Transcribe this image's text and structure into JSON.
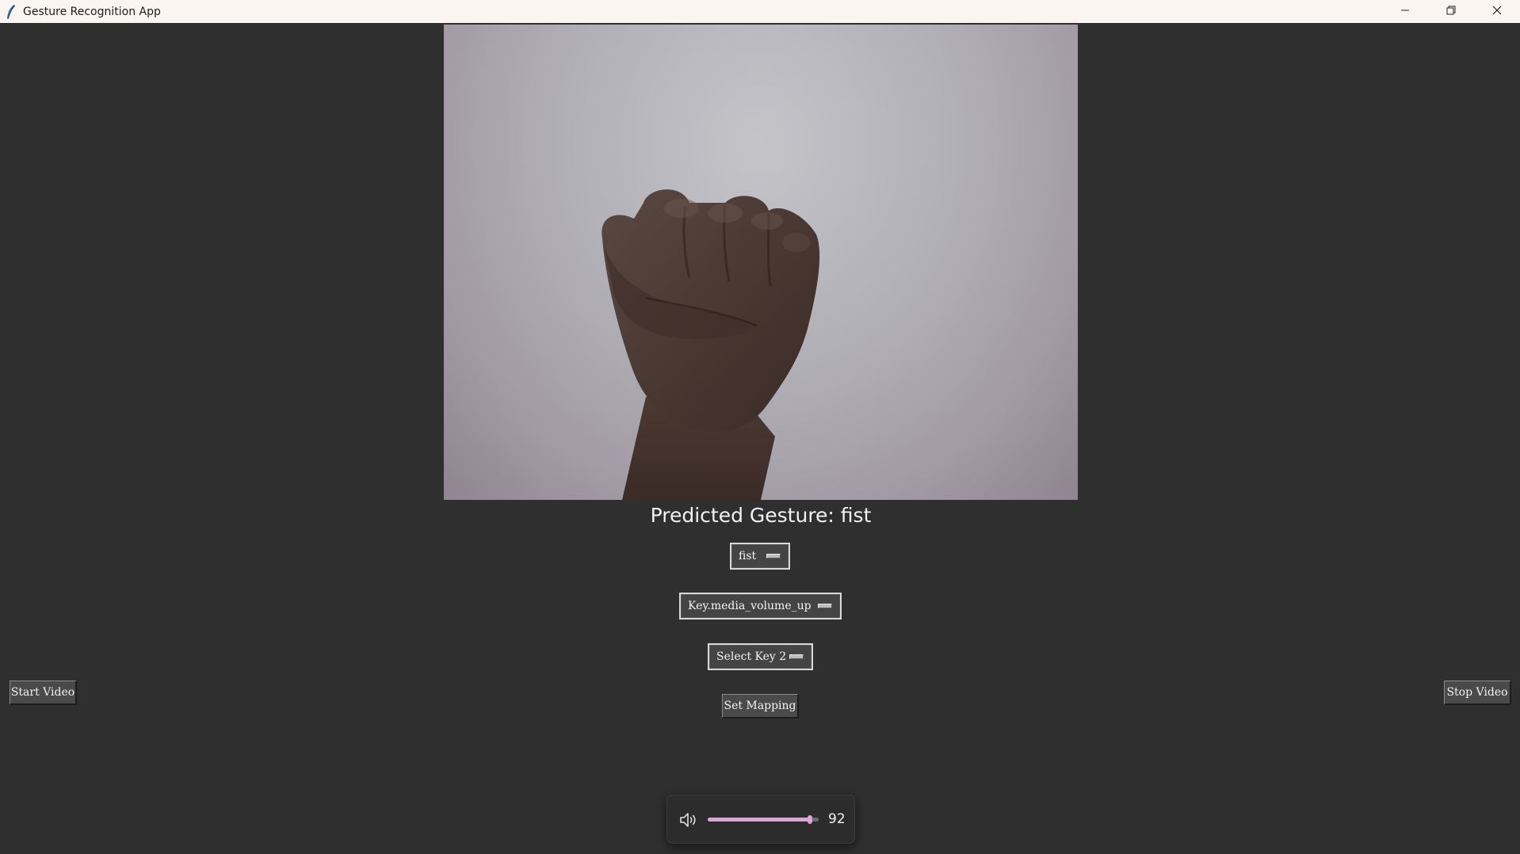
{
  "window": {
    "title": "Gesture Recognition App",
    "controls": [
      "minimize-icon",
      "restore-icon",
      "close-icon"
    ]
  },
  "video": {
    "content": "webcam-feed-fist"
  },
  "predicted_label": "Predicted Gesture: fist",
  "gesture_menu": {
    "value": "fist"
  },
  "key1_menu": {
    "value": "Key.media_volume_up"
  },
  "key2_menu": {
    "value": "Select Key 2"
  },
  "buttons": {
    "set_mapping": "Set Mapping",
    "start_video": "Start Video",
    "stop_video": "Stop Video"
  },
  "volume": {
    "icon": "speaker-icon",
    "level": 92,
    "display": "92",
    "accent_color": "#d9a6d8"
  },
  "colors": {
    "background": "#2f2f2f",
    "titlebar": "#fbf5f2"
  }
}
